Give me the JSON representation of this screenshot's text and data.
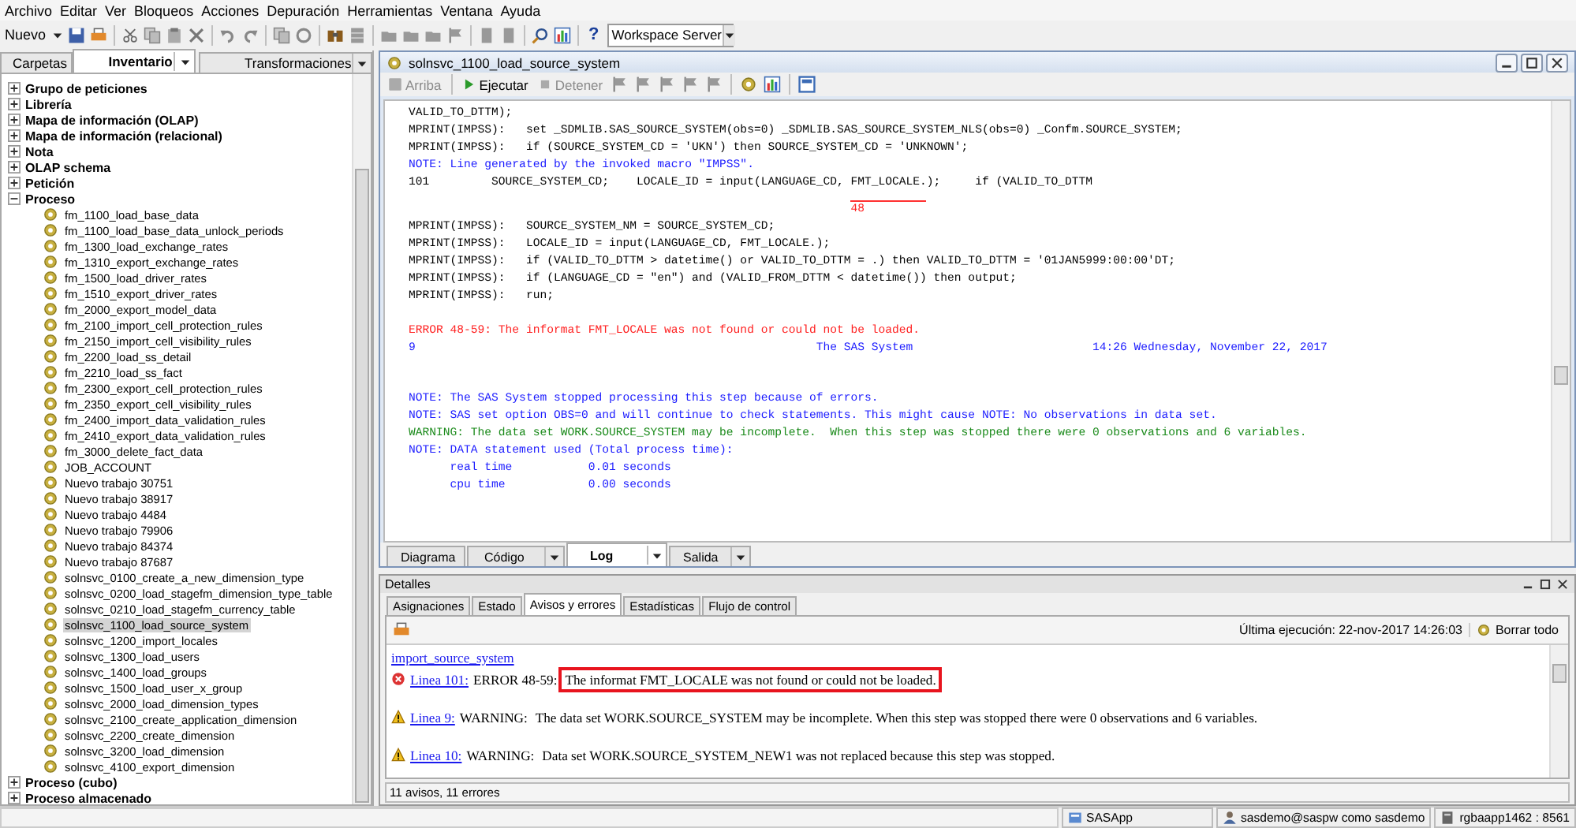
{
  "menu": [
    "Archivo",
    "Editar",
    "Ver",
    "Bloqueos",
    "Acciones",
    "Depuración",
    "Herramientas",
    "Ventana",
    "Ayuda"
  ],
  "toolbar": {
    "new_button": "Nuevo",
    "help_button": "?",
    "server_combo": "Workspace Server"
  },
  "left_tabs": [
    {
      "label": "Carpetas",
      "selected": false,
      "dropdown": false
    },
    {
      "label": "Inventario",
      "selected": true,
      "dropdown": true
    },
    {
      "label": "Transformaciones",
      "selected": false,
      "dropdown": true
    }
  ],
  "tree": [
    {
      "label": "Grupo de peticiones",
      "expanded": false,
      "selected": false
    },
    {
      "label": "Librería",
      "expanded": false,
      "selected": false
    },
    {
      "label": "Mapa de información (OLAP)",
      "expanded": false,
      "selected": false
    },
    {
      "label": "Mapa de información (relacional)",
      "expanded": false,
      "selected": false
    },
    {
      "label": "Nota",
      "expanded": false,
      "selected": false
    },
    {
      "label": "OLAP schema",
      "expanded": false,
      "selected": false
    },
    {
      "label": "Petición",
      "expanded": false,
      "selected": false
    },
    {
      "label": "Proceso",
      "expanded": true,
      "selected": false,
      "children": [
        {
          "label": "fm_1100_load_base_data",
          "selected": false
        },
        {
          "label": "fm_1100_load_base_data_unlock_periods",
          "selected": false
        },
        {
          "label": "fm_1300_load_exchange_rates",
          "selected": false
        },
        {
          "label": "fm_1310_export_exchange_rates",
          "selected": false
        },
        {
          "label": "fm_1500_load_driver_rates",
          "selected": false
        },
        {
          "label": "fm_1510_export_driver_rates",
          "selected": false
        },
        {
          "label": "fm_2000_export_model_data",
          "selected": false
        },
        {
          "label": "fm_2100_import_cell_protection_rules",
          "selected": false
        },
        {
          "label": "fm_2150_import_cell_visibility_rules",
          "selected": false
        },
        {
          "label": "fm_2200_load_ss_detail",
          "selected": false
        },
        {
          "label": "fm_2210_load_ss_fact",
          "selected": false
        },
        {
          "label": "fm_2300_export_cell_protection_rules",
          "selected": false
        },
        {
          "label": "fm_2350_export_cell_visibility_rules",
          "selected": false
        },
        {
          "label": "fm_2400_import_data_validation_rules",
          "selected": false
        },
        {
          "label": "fm_2410_export_data_validation_rules",
          "selected": false
        },
        {
          "label": "fm_3000_delete_fact_data",
          "selected": false
        },
        {
          "label": "JOB_ACCOUNT",
          "selected": false
        },
        {
          "label": "Nuevo trabajo 30751",
          "selected": false
        },
        {
          "label": "Nuevo trabajo 38917",
          "selected": false
        },
        {
          "label": "Nuevo trabajo 4484",
          "selected": false
        },
        {
          "label": "Nuevo trabajo 79906",
          "selected": false
        },
        {
          "label": "Nuevo trabajo 84374",
          "selected": false
        },
        {
          "label": "Nuevo trabajo 87687",
          "selected": false
        },
        {
          "label": "solnsvc_0100_create_a_new_dimension_type",
          "selected": false
        },
        {
          "label": "solnsvc_0200_load_stagefm_dimension_type_table",
          "selected": false
        },
        {
          "label": "solnsvc_0210_load_stagefm_currency_table",
          "selected": false
        },
        {
          "label": "solnsvc_1100_load_source_system",
          "selected": true
        },
        {
          "label": "solnsvc_1200_import_locales",
          "selected": false
        },
        {
          "label": "solnsvc_1300_load_users",
          "selected": false
        },
        {
          "label": "solnsvc_1400_load_groups",
          "selected": false
        },
        {
          "label": "solnsvc_1500_load_user_x_group",
          "selected": false
        },
        {
          "label": "solnsvc_2000_load_dimension_types",
          "selected": false
        },
        {
          "label": "solnsvc_2100_create_application_dimension",
          "selected": false
        },
        {
          "label": "solnsvc_2200_create_dimension",
          "selected": false
        },
        {
          "label": "solnsvc_3200_load_dimension",
          "selected": false
        },
        {
          "label": "solnsvc_4100_export_dimension",
          "selected": false
        }
      ]
    },
    {
      "label": "Proceso (cubo)",
      "expanded": false,
      "selected": false
    },
    {
      "label": "Proceso almacenado",
      "expanded": false,
      "selected": false
    }
  ],
  "editor": {
    "title": "solnsvc_1100_load_source_system",
    "toolbar": [
      {
        "label": "Arriba",
        "kind": "up",
        "disabled": true
      },
      {
        "label": "Ejecutar",
        "kind": "run",
        "disabled": false
      },
      {
        "label": "Detener",
        "kind": "stop",
        "disabled": true
      }
    ],
    "log": [
      {
        "kind": "text",
        "text": "VALID_TO_DTTM);"
      },
      {
        "kind": "text",
        "text": "MPRINT(IMPSS):   set _SDMLIB.SAS_SOURCE_SYSTEM(obs=0) _SDMLIB.SAS_SOURCE_SYSTEM_NLS(obs=0) _Confm.SOURCE_SYSTEM;"
      },
      {
        "kind": "text",
        "text": "MPRINT(IMPSS):   if (SOURCE_SYSTEM_CD = 'UKN') then SOURCE_SYSTEM_CD = 'UNKNOWN';"
      },
      {
        "kind": "note",
        "text": "NOTE: Line generated by the invoked macro \"IMPSS\"."
      },
      {
        "kind": "text",
        "text": "101         SOURCE_SYSTEM_CD;    LOCALE_ID = input(LANGUAGE_CD, FMT_LOCALE.);     if (VALID_TO_DTTM"
      },
      {
        "kind": "marker",
        "text": "                                                                48"
      },
      {
        "kind": "text",
        "text": "MPRINT(IMPSS):   SOURCE_SYSTEM_NM = SOURCE_SYSTEM_CD;"
      },
      {
        "kind": "text",
        "text": "MPRINT(IMPSS):   LOCALE_ID = input(LANGUAGE_CD, FMT_LOCALE.);"
      },
      {
        "kind": "text",
        "text": "MPRINT(IMPSS):   if (VALID_TO_DTTM > datetime() or VALID_TO_DTTM = .) then VALID_TO_DTTM = '01JAN5999:00:00'DT;"
      },
      {
        "kind": "text",
        "text": "MPRINT(IMPSS):   if (LANGUAGE_CD = \"en\") and (VALID_FROM_DTTM < datetime()) then output;"
      },
      {
        "kind": "text",
        "text": "MPRINT(IMPSS):   run;"
      },
      {
        "kind": "blank"
      },
      {
        "kind": "error",
        "text": "ERROR 48-59: The informat FMT_LOCALE was not found or could not be loaded."
      },
      {
        "kind": "note",
        "text": "9                                                          The SAS System                          14:26 Wednesday, November 22, 2017"
      },
      {
        "kind": "blank"
      },
      {
        "kind": "blank"
      },
      {
        "kind": "note",
        "text": "NOTE: The SAS System stopped processing this step because of errors."
      },
      {
        "kind": "note",
        "text": "NOTE: SAS set option OBS=0 and will continue to check statements. This might cause NOTE: No observations in data set."
      },
      {
        "kind": "warning",
        "text": "WARNING: The data set WORK.SOURCE_SYSTEM may be incomplete.  When this step was stopped there were 0 observations and 6 variables."
      },
      {
        "kind": "note",
        "text": "NOTE: DATA statement used (Total process time):"
      },
      {
        "kind": "note",
        "text": "      real time           0.01 seconds"
      },
      {
        "kind": "note",
        "text": "      cpu time            0.00 seconds"
      }
    ],
    "tabs": [
      {
        "label": "Diagrama",
        "selected": false,
        "dropdown": false
      },
      {
        "label": "Código",
        "selected": false,
        "dropdown": true
      },
      {
        "label": "Log",
        "selected": true,
        "dropdown": true
      },
      {
        "label": "Salida",
        "selected": false,
        "dropdown": true
      }
    ]
  },
  "details": {
    "title": "Detalles",
    "tabs": [
      {
        "label": "Asignaciones",
        "selected": false
      },
      {
        "label": "Estado",
        "selected": false
      },
      {
        "label": "Avisos y errores",
        "selected": true
      },
      {
        "label": "Estadísticas",
        "selected": false
      },
      {
        "label": "Flujo de control",
        "selected": false
      }
    ],
    "last_run": "Última ejecución: 22-nov-2017 14:26:03",
    "clear_button": "Borrar todo",
    "job_link": "import_source_system",
    "messages": [
      {
        "kind": "error",
        "link": "Linea 101:",
        "prefix": "ERROR 48-59:",
        "text": "The informat FMT_LOCALE was not found or could not be loaded.",
        "highlighted": true
      },
      {
        "kind": "warning",
        "link": "Linea 9:",
        "prefix": "WARNING:",
        "text": "The data set WORK.SOURCE_SYSTEM may be incomplete. When this step was stopped there were 0 observations and 6 variables.",
        "highlighted": false
      },
      {
        "kind": "warning",
        "link": "Linea 10:",
        "prefix": "WARNING:",
        "text": "Data set WORK.SOURCE_SYSTEM_NEW1 was not replaced because this step was stopped.",
        "highlighted": false
      }
    ],
    "summary": "11 avisos, 11 errores"
  },
  "status_bar": [
    {
      "kind": "server",
      "text": "SASApp"
    },
    {
      "kind": "user",
      "text": "sasdemo@saspw como sasdemo"
    },
    {
      "kind": "host",
      "text": "rgbaapp1462 : 8561"
    }
  ]
}
